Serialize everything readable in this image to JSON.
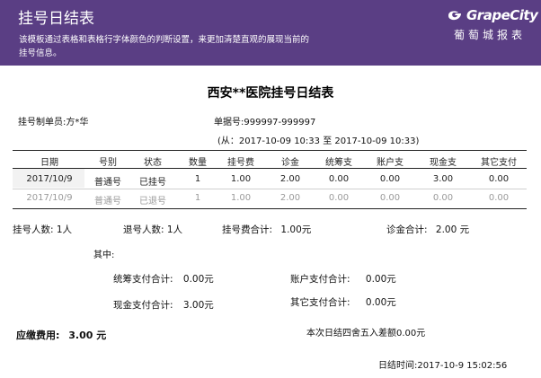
{
  "header": {
    "title": "挂号日结表",
    "description": "该模板通过表格和表格行字体颜色的判断设置，来更加清楚直观的展现当前的挂号信息。",
    "brand_name": "GrapeCity",
    "brand_sub": "葡萄城报表",
    "brand_color": "#5a3e84"
  },
  "report": {
    "title": "西安**医院挂号日结表",
    "operator_label": "挂号制单员:",
    "operator_value": "方*华",
    "doc_no_label": "单据号:",
    "doc_no_value": "999997-999997",
    "range_text": "(从：2017-10-09 10:33 至 2017-10-09 10:33)"
  },
  "table": {
    "columns": [
      "日期",
      "号别",
      "状态",
      "数量",
      "挂号费",
      "诊金",
      "统筹支",
      "账户支",
      "现金支",
      "其它支付"
    ],
    "rows": [
      {
        "cells": [
          "2017/10/9",
          "普通号",
          "已挂号",
          "1",
          "1.00",
          "2.00",
          "0.00",
          "0.00",
          "3.00",
          "0.00"
        ],
        "style": "normal"
      },
      {
        "cells": [
          "2017/10/9",
          "普通号",
          "已退号",
          "1",
          "1.00",
          "2.00",
          "0.00",
          "0.00",
          "0.00",
          "0.00"
        ],
        "style": "gray"
      }
    ]
  },
  "summary": {
    "reg_count": "挂号人数: 1人",
    "refund_count": "退号人数: 1人",
    "reg_fee_label": "挂号费合计:",
    "reg_fee_value": "1.00元",
    "consult_fee_label": "诊金合计:",
    "consult_fee_value": "2.00 元",
    "of_which": "其中:",
    "pooled_label": "统筹支付合计:",
    "pooled_value": "0.00元",
    "account_label": "账户支付合计:",
    "account_value": "0.00元",
    "cash_label": "现金支付合计:",
    "cash_value": "3.00元",
    "other_label": "其它支付合计:",
    "other_value": "0.00元",
    "due_label": "应缴费用:",
    "due_value": "3.00 元",
    "rounding_text": "本次日结四舍五入差额0.00元",
    "settle_time_label": "日结时间:",
    "settle_time_value": "2017-10-9  15:02:56"
  }
}
